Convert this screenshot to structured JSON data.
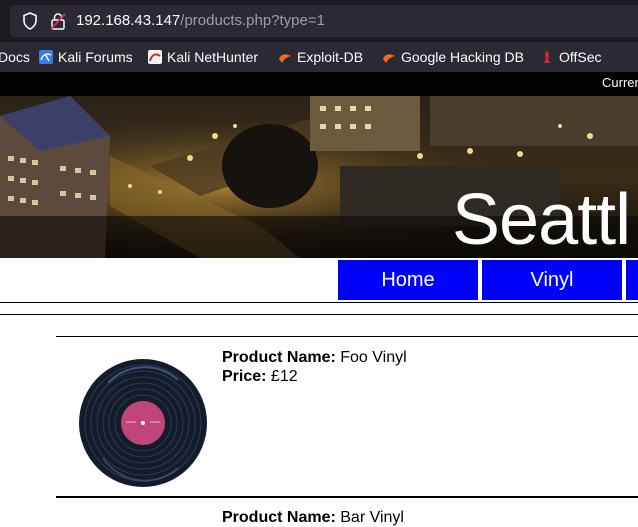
{
  "browser": {
    "url_host": "192.168.43.147",
    "url_path": "/products.php?type=1"
  },
  "bookmarks": [
    {
      "label": "Docs",
      "icon": "docs-icon"
    },
    {
      "label": "Kali Forums",
      "icon": "kali-forums-icon"
    },
    {
      "label": "Kali NetHunter",
      "icon": "kali-nethunter-icon"
    },
    {
      "label": "Exploit-DB",
      "icon": "exploit-db-icon"
    },
    {
      "label": "Google Hacking DB",
      "icon": "google-hacking-db-icon"
    },
    {
      "label": "OffSec",
      "icon": "offsec-icon"
    }
  ],
  "header": {
    "strip_text": "Curren",
    "title": "Seattl"
  },
  "nav": [
    {
      "label": "Home"
    },
    {
      "label": "Vinyl"
    },
    {
      "label": ""
    }
  ],
  "products": [
    {
      "name_label": "Product Name:",
      "name": " Foo Vinyl",
      "price_label": "Price:",
      "price": " £12",
      "image": "vinyl-record"
    },
    {
      "name_label": "Product Name:",
      "name": " Bar Vinyl"
    }
  ],
  "colors": {
    "nav_button": "#0000ff",
    "browser_bg": "#1c1b22",
    "url_host": "#fbfbfe",
    "url_path": "#9e9ea6"
  }
}
